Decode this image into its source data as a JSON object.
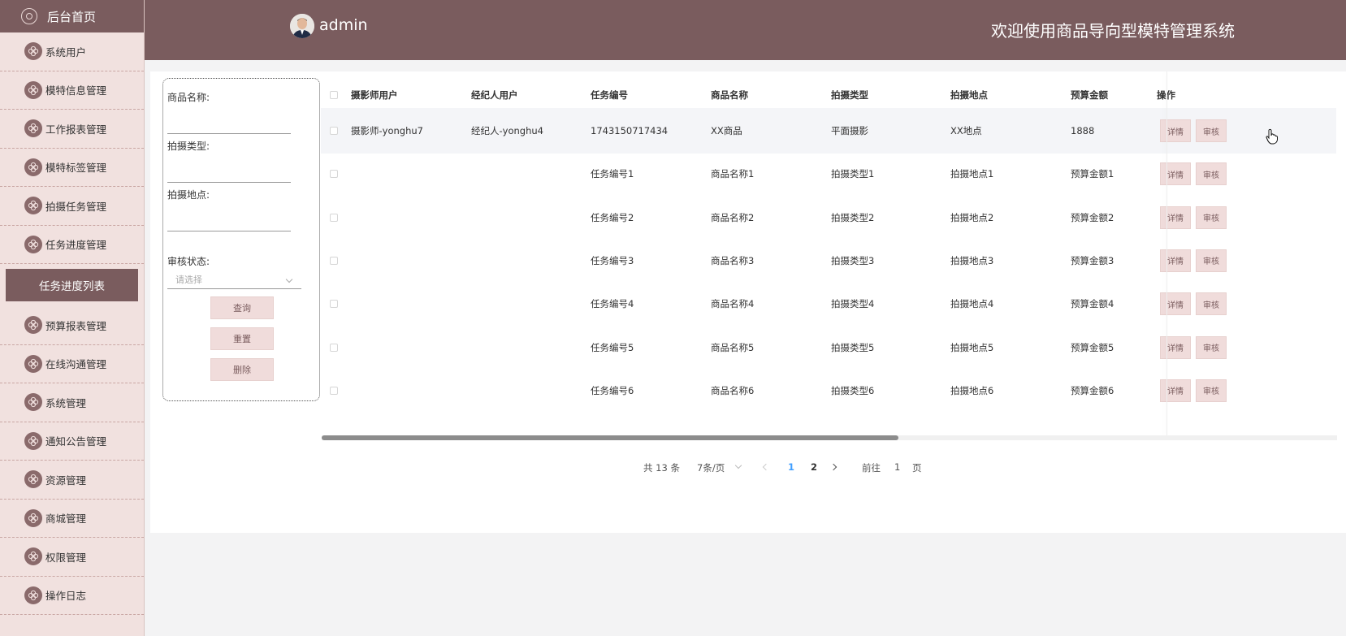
{
  "sidebar": {
    "home_label": "后台首页",
    "items_top": [
      "系统用户",
      "模特信息管理",
      "工作报表管理",
      "模特标签管理",
      "拍摄任务管理",
      "任务进度管理"
    ],
    "active_sub": "任务进度列表",
    "items_bottom": [
      "预算报表管理",
      "在线沟通管理",
      "系统管理",
      "通知公告管理",
      "资源管理",
      "商城管理",
      "权限管理",
      "操作日志"
    ]
  },
  "header": {
    "username": "admin",
    "title": "欢迎使用商品导向型模特管理系统"
  },
  "search": {
    "label_product": "商品名称:",
    "label_shoot_type": "拍摄类型:",
    "label_location": "拍摄地点:",
    "label_status": "审核状态:",
    "status_placeholder": "请选择",
    "btn_query": "查询",
    "btn_reset": "重置",
    "btn_delete": "删除"
  },
  "table": {
    "headers": [
      "摄影师用户",
      "经纪人用户",
      "任务编号",
      "商品名称",
      "拍摄类型",
      "拍摄地点",
      "预算金额",
      "操作"
    ],
    "rows": [
      [
        "摄影师-yonghu7",
        "经纪人-yonghu4",
        "1743150717434",
        "XX商品",
        "平面摄影",
        "XX地点",
        "1888"
      ],
      [
        "",
        "",
        "任务编号1",
        "商品名称1",
        "拍摄类型1",
        "拍摄地点1",
        "预算金额1"
      ],
      [
        "",
        "",
        "任务编号2",
        "商品名称2",
        "拍摄类型2",
        "拍摄地点2",
        "预算金额2"
      ],
      [
        "",
        "",
        "任务编号3",
        "商品名称3",
        "拍摄类型3",
        "拍摄地点3",
        "预算金额3"
      ],
      [
        "",
        "",
        "任务编号4",
        "商品名称4",
        "拍摄类型4",
        "拍摄地点4",
        "预算金额4"
      ],
      [
        "",
        "",
        "任务编号5",
        "商品名称5",
        "拍摄类型5",
        "拍摄地点5",
        "预算金额5"
      ],
      [
        "",
        "",
        "任务编号6",
        "商品名称6",
        "拍摄类型6",
        "拍摄地点6",
        "预算金额6"
      ]
    ],
    "btn_detail": "详情",
    "btn_review": "审核"
  },
  "pagination": {
    "total": "共 13 条",
    "page_size": "7条/页",
    "pages": [
      "1",
      "2"
    ],
    "current": "1",
    "goto_label": "前往",
    "goto_value": "1",
    "goto_suffix": "页"
  },
  "colors": {
    "primary": "#7a5c5e",
    "sidebar_bg": "#f1e1df",
    "button_bg": "#f0dcdb",
    "active_page": "#409eff"
  }
}
